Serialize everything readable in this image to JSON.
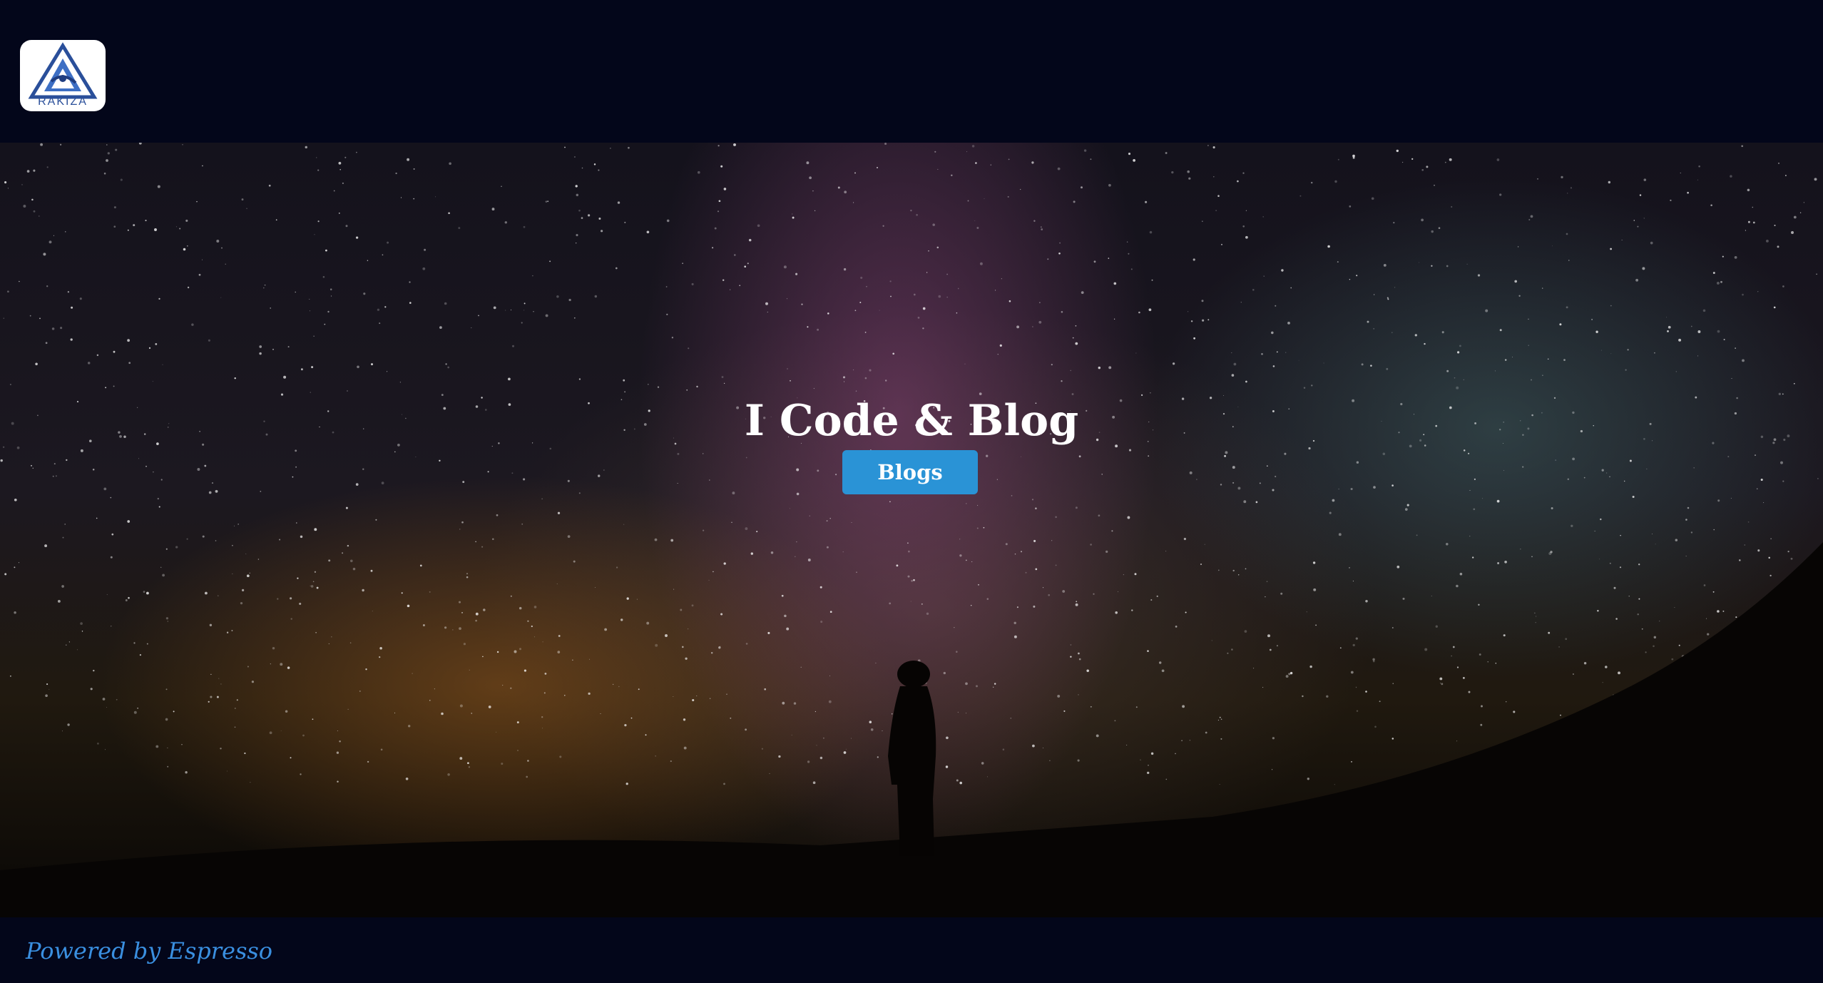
{
  "header": {
    "logo": {
      "text": "RAKIZA",
      "icon": "triangle-logo-icon",
      "color": "#2a4f9a"
    }
  },
  "hero": {
    "title": "I Code & Blog",
    "button_label": "Blogs",
    "button_color": "#2a93d6"
  },
  "footer": {
    "powered_by": "Powered by Espresso",
    "link_color": "#3a8fe0"
  },
  "colors": {
    "page_background": "#03061a"
  }
}
